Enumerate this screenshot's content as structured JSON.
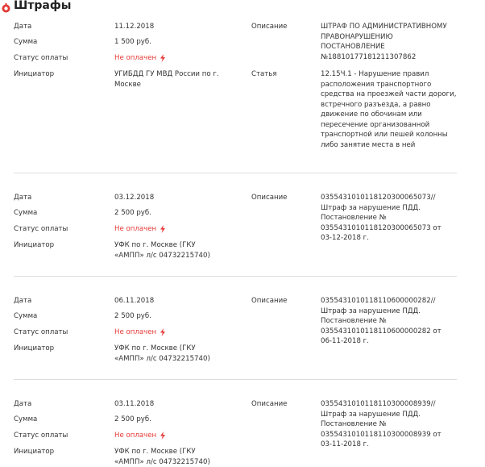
{
  "header": {
    "title": "Штрафы"
  },
  "labels": {
    "date": "Дата",
    "amount": "Сумма",
    "status": "Статус оплаты",
    "initiator": "Инициатор",
    "description": "Описание",
    "article": "Статья"
  },
  "fines": [
    {
      "date": "11.12.2018",
      "amount": "1 500 руб.",
      "status": "Не оплачен",
      "initiator": [
        "УГИБДД ГУ МВД России по г.",
        "Москве"
      ],
      "description": [
        "ШТРАФ ПО АДМИНИСТРАТИВНОМУ",
        "ПРАВОНАРУШЕНИЮ",
        "ПОСТАНОВЛЕНИЕ",
        "№18810177181211307862"
      ],
      "article": [
        "12.15Ч.1 - Нарушение правил",
        "расположения транспортного",
        "средства на проезжей части дороги,",
        "встречного разъезда, а равно",
        "движение по обочинам или",
        "пересечение организованной",
        "транспортной или пешей колонны",
        "либо занятие места в ней"
      ]
    },
    {
      "date": "03.12.2018",
      "amount": "2 500 руб.",
      "status": "Не оплачен",
      "initiator": [
        "УФК по г. Москве (ГКУ",
        "«АМПП» л/с 04732215740)"
      ],
      "description": [
        "0355431010118120300065073//",
        "Штраф за нарушение ПДД.",
        "Постановление №",
        "0355431010118120300065073 от",
        "03-12-2018 г."
      ]
    },
    {
      "date": "06.11.2018",
      "amount": "2 500 руб.",
      "status": "Не оплачен",
      "initiator": [
        "УФК по г. Москве (ГКУ",
        "«АМПП» л/с 04732215740)"
      ],
      "description": [
        "0355431010118110600000282//",
        "Штраф за нарушение ПДД.",
        "Постановление №",
        "0355431010118110600000282 от",
        "06-11-2018 г."
      ]
    },
    {
      "date": "03.11.2018",
      "amount": "2 500 руб.",
      "status": "Не оплачен",
      "initiator": [
        "УФК по г. Москве (ГКУ",
        "«АМПП» л/с 04732215740)"
      ],
      "description": [
        "0355431010118110300008939//",
        "Штраф за нарушение ПДД.",
        "Постановление №",
        "0355431010118110300008939 от",
        "03-11-2018 г."
      ]
    }
  ],
  "colors": {
    "status": "#e53935",
    "accent": "#e53935",
    "divider": "#dddddd"
  }
}
